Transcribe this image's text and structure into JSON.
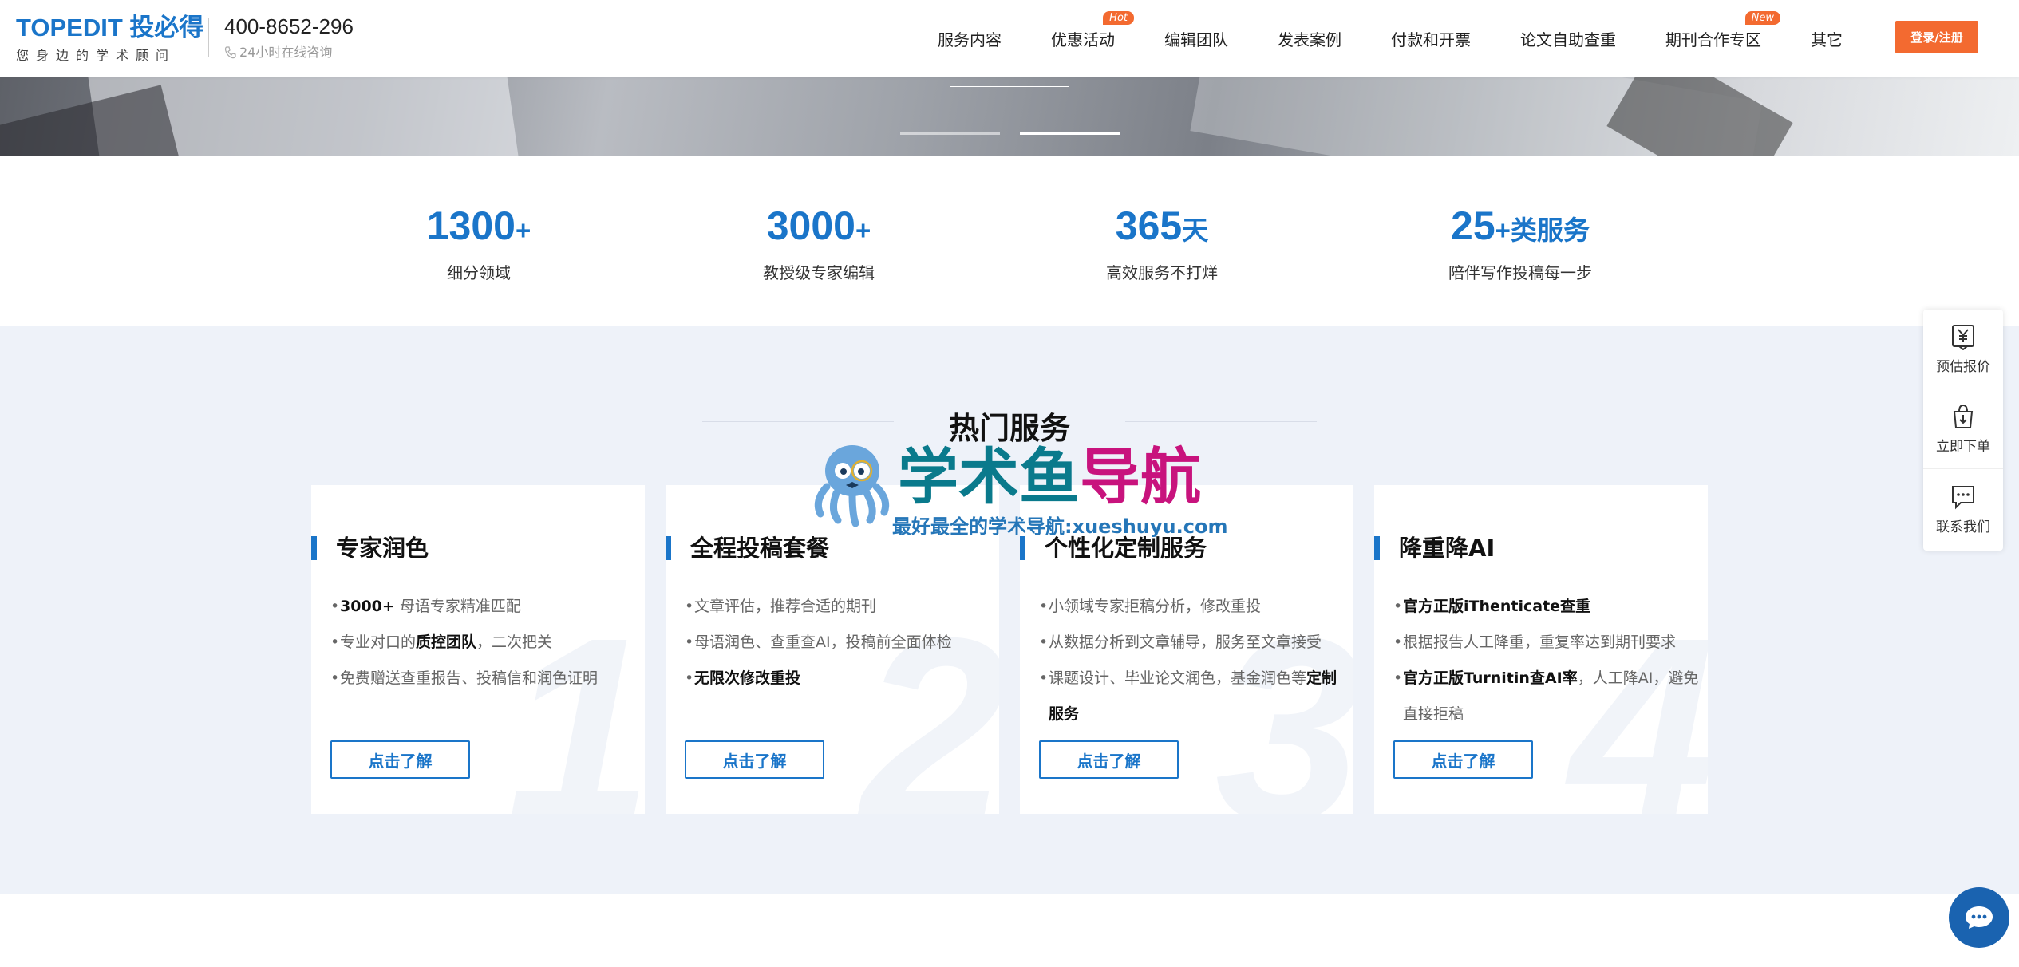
{
  "header": {
    "logo_text": "TOPEDIT 投必得",
    "logo_tagline": "您身边的学术顾问",
    "phone": "400-8652-296",
    "phone_sub": "24小时在线咨询",
    "nav": [
      {
        "label": "服务内容",
        "badge": ""
      },
      {
        "label": "优惠活动",
        "badge": "Hot"
      },
      {
        "label": "编辑团队",
        "badge": ""
      },
      {
        "label": "发表案例",
        "badge": ""
      },
      {
        "label": "付款和开票",
        "badge": ""
      },
      {
        "label": "论文自助查重",
        "badge": ""
      },
      {
        "label": "期刊合作专区",
        "badge": "New"
      },
      {
        "label": "其它",
        "badge": ""
      }
    ],
    "login_label": "登录/注册"
  },
  "stats": [
    {
      "value": "1300",
      "suffix": "+",
      "label": "细分领域"
    },
    {
      "value": "3000",
      "suffix": "+",
      "label": "教授级专家编辑"
    },
    {
      "value": "365",
      "suffix": "天",
      "label": "高效服务不打烊"
    },
    {
      "value": "25",
      "suffix": "+类服务",
      "label": "陪伴写作投稿每一步"
    }
  ],
  "services": {
    "title": "热门服务",
    "cards": [
      {
        "title": "专家润色",
        "num": "1",
        "button": "点击了解",
        "items": [
          {
            "pre": "",
            "bold": "3000+",
            "post": " 母语专家精准匹配"
          },
          {
            "pre": "专业对口的",
            "bold": "质控团队",
            "post": "，二次把关"
          },
          {
            "pre": "免费赠送查重报告、投稿信和润色证明",
            "bold": "",
            "post": ""
          }
        ]
      },
      {
        "title": "全程投稿套餐",
        "num": "2",
        "button": "点击了解",
        "items": [
          {
            "pre": "文章评估，推荐合适的期刊",
            "bold": "",
            "post": ""
          },
          {
            "pre": "母语润色、查重查AI，投稿前全面体检",
            "bold": "",
            "post": ""
          },
          {
            "pre": "",
            "bold": "无限次修改重投",
            "post": ""
          }
        ]
      },
      {
        "title": "个性化定制服务",
        "num": "3",
        "button": "点击了解",
        "items": [
          {
            "pre": "小领域专家拒稿分析，修改重投",
            "bold": "",
            "post": ""
          },
          {
            "pre": "从数据分析到文章辅导，服务至文章接受",
            "bold": "",
            "post": ""
          },
          {
            "pre": "课题设计、毕业论文润色，基金润色等",
            "bold": "定制服务",
            "post": ""
          }
        ]
      },
      {
        "title": "降重降AI",
        "num": "4",
        "button": "点击了解",
        "items": [
          {
            "pre": "",
            "bold": "官方正版iThenticate查重",
            "post": ""
          },
          {
            "pre": "根据报告人工降重，重复率达到期刊要求",
            "bold": "",
            "post": ""
          },
          {
            "pre": "",
            "bold": "官方正版Turnitin查AI率",
            "post": "，人工降AI，避免直接拒稿"
          }
        ]
      }
    ]
  },
  "watermark": {
    "text_a": "学术鱼",
    "text_b": "导航",
    "sub": "最好最全的学术导航:xueshuyu.com"
  },
  "side_panel": [
    {
      "label": "预估报价",
      "icon": "yen-doc-icon"
    },
    {
      "label": "立即下单",
      "icon": "shopping-bag-icon"
    },
    {
      "label": "联系我们",
      "icon": "chat-bubble-icon"
    }
  ],
  "colors": {
    "brand": "#1a75c9",
    "accent": "#f36a30",
    "section_bg": "#eef2f9"
  }
}
